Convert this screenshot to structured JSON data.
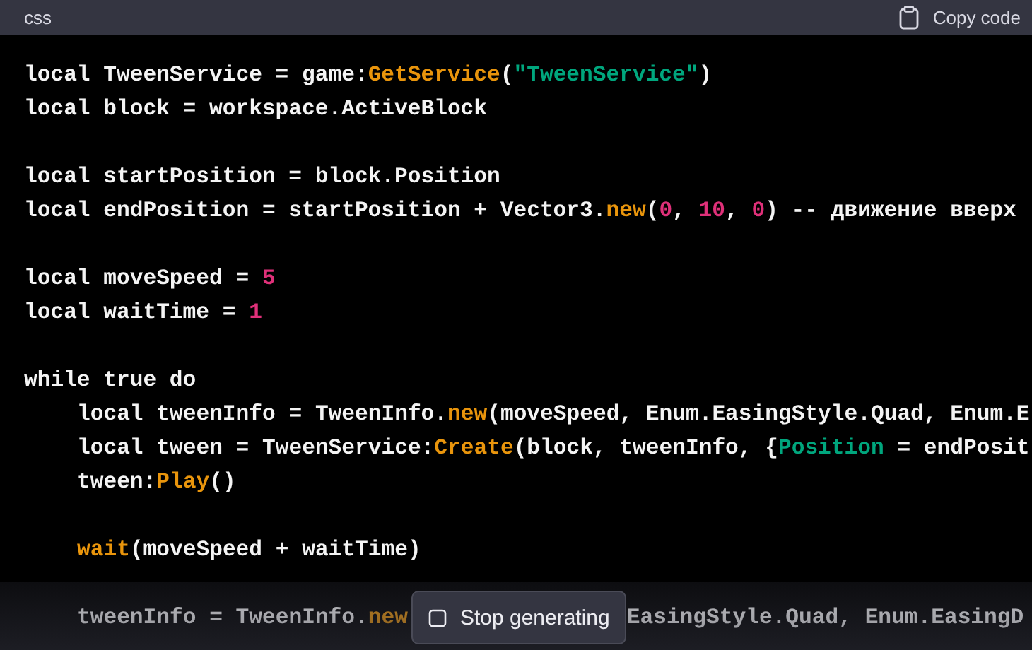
{
  "header": {
    "language": "css",
    "copy_label": "Copy code"
  },
  "lines": [
    {
      "kind": "code",
      "tokens": [
        {
          "kind": "plain",
          "text": "local TweenService = game:"
        },
        {
          "kind": "func",
          "text": "GetService"
        },
        {
          "kind": "plain",
          "text": "("
        },
        {
          "kind": "string",
          "text": "\"TweenService\""
        },
        {
          "kind": "plain",
          "text": ")"
        }
      ]
    },
    {
      "kind": "code",
      "tokens": [
        {
          "kind": "plain",
          "text": "local block = workspace.ActiveBlock"
        }
      ]
    },
    {
      "kind": "blank"
    },
    {
      "kind": "code",
      "tokens": [
        {
          "kind": "plain",
          "text": "local startPosition = block.Position"
        }
      ]
    },
    {
      "kind": "code",
      "tokens": [
        {
          "kind": "plain",
          "text": "local endPosition = startPosition + Vector3."
        },
        {
          "kind": "func",
          "text": "new"
        },
        {
          "kind": "plain",
          "text": "("
        },
        {
          "kind": "number",
          "text": "0"
        },
        {
          "kind": "plain",
          "text": ", "
        },
        {
          "kind": "number",
          "text": "10"
        },
        {
          "kind": "plain",
          "text": ", "
        },
        {
          "kind": "number",
          "text": "0"
        },
        {
          "kind": "plain",
          "text": ") -- движение вверх"
        }
      ]
    },
    {
      "kind": "blank"
    },
    {
      "kind": "code",
      "tokens": [
        {
          "kind": "plain",
          "text": "local moveSpeed = "
        },
        {
          "kind": "number",
          "text": "5"
        }
      ]
    },
    {
      "kind": "code",
      "tokens": [
        {
          "kind": "plain",
          "text": "local waitTime = "
        },
        {
          "kind": "number",
          "text": "1"
        }
      ]
    },
    {
      "kind": "blank"
    },
    {
      "kind": "code",
      "tokens": [
        {
          "kind": "plain",
          "text": "while true do"
        }
      ],
      "children": [
        {
          "kind": "code",
          "tokens": [
            {
              "kind": "plain",
              "text": "local tweenInfo = TweenInfo."
            },
            {
              "kind": "func",
              "text": "new"
            },
            {
              "kind": "plain",
              "text": "(moveSpeed, Enum.EasingStyle.Quad, Enum.E"
            }
          ]
        },
        {
          "kind": "code",
          "tokens": [
            {
              "kind": "plain",
              "text": "local tween = TweenService:"
            },
            {
              "kind": "func",
              "text": "Create"
            },
            {
              "kind": "plain",
              "text": "(block, tweenInfo, {"
            },
            {
              "kind": "string",
              "text": "Position"
            },
            {
              "kind": "plain",
              "text": " = endPosit"
            }
          ]
        },
        {
          "kind": "code",
          "tokens": [
            {
              "kind": "plain",
              "text": "tween:"
            },
            {
              "kind": "func",
              "text": "Play"
            },
            {
              "kind": "plain",
              "text": "()"
            }
          ]
        },
        {
          "kind": "blank"
        },
        {
          "kind": "code",
          "tokens": [
            {
              "kind": "func",
              "text": "wait"
            },
            {
              "kind": "plain",
              "text": "(moveSpeed + waitTime)"
            }
          ]
        },
        {
          "kind": "blank"
        },
        {
          "kind": "code",
          "tokens": [
            {
              "kind": "plain",
              "text": "tweenInfo = TweenInfo."
            },
            {
              "kind": "func",
              "text": "new"
            },
            {
              "kind": "covered"
            },
            {
              "kind": "plain",
              "text": "EasingStyle.Quad, Enum.EasingD"
            }
          ]
        }
      ]
    }
  ],
  "stop_button": {
    "label": "Stop generating"
  }
}
